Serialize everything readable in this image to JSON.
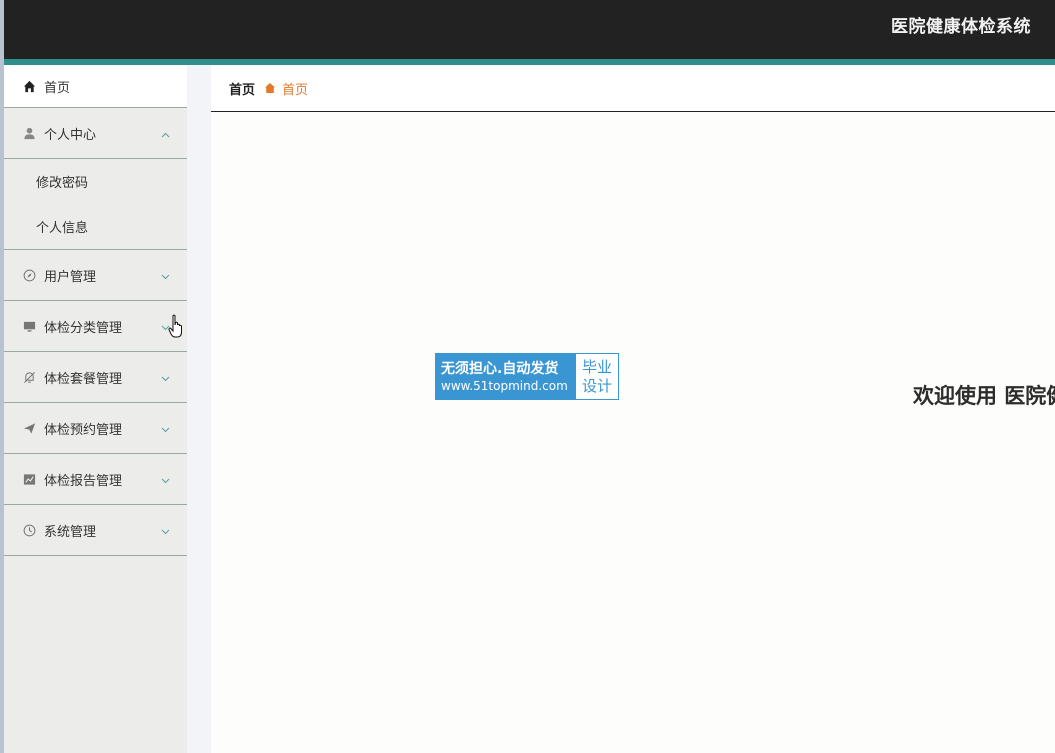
{
  "header": {
    "title": "医院健康体检系统"
  },
  "sidebar": {
    "home": {
      "label": "首页",
      "icon": "home-icon"
    },
    "personal": {
      "label": "个人中心",
      "icon": "user-icon",
      "children": [
        {
          "label": "修改密码"
        },
        {
          "label": "个人信息"
        }
      ]
    },
    "items": [
      {
        "label": "用户管理",
        "icon": "compass-icon"
      },
      {
        "label": "体检分类管理",
        "icon": "monitor-icon"
      },
      {
        "label": "体检套餐管理",
        "icon": "bell-off-icon"
      },
      {
        "label": "体检预约管理",
        "icon": "paper-plane-icon"
      },
      {
        "label": "体检报告管理",
        "icon": "chart-icon"
      },
      {
        "label": "系统管理",
        "icon": "clock-icon"
      }
    ]
  },
  "breadcrumb": {
    "home": "首页",
    "current": "首页"
  },
  "main": {
    "welcome": "欢迎使用 医院健康体检系统"
  },
  "watermark": {
    "line1": "无须担心.自动发货",
    "line2": "www.51topmind.com",
    "tag1": "毕业",
    "tag2": "设计"
  },
  "colors": {
    "topbar": "#222222",
    "accent": "#2e8f8c",
    "crumb_current": "#e5792b",
    "watermark": "#3a95d3"
  }
}
